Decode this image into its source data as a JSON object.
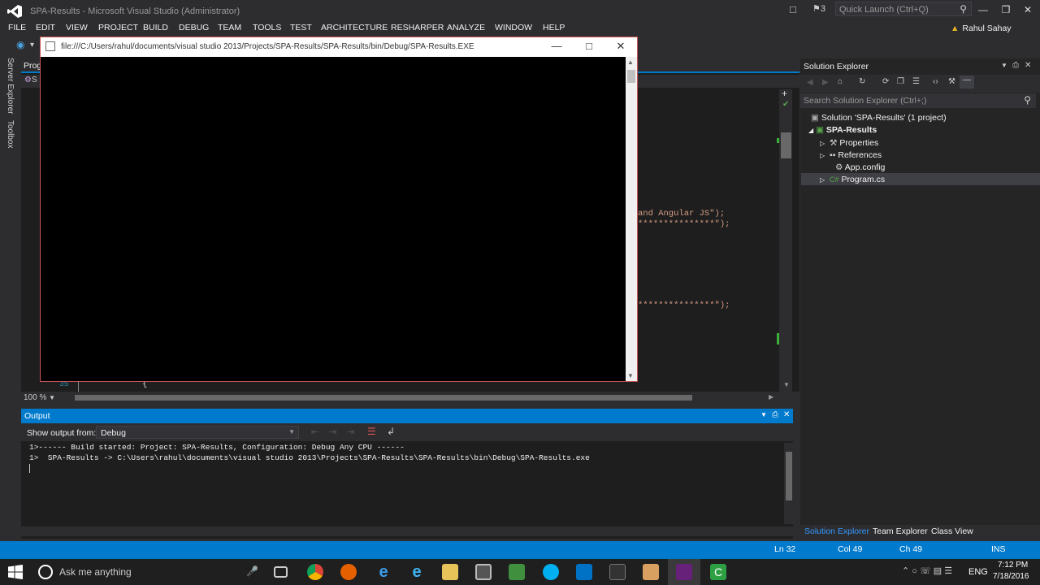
{
  "window": {
    "title": "SPA-Results - Microsoft Visual Studio (Administrator)",
    "notifications": "3",
    "quick_launch_placeholder": "Quick Launch (Ctrl+Q)",
    "user": "Rahul Sahay"
  },
  "menu": [
    "FILE",
    "EDIT",
    "VIEW",
    "PROJECT",
    "BUILD",
    "DEBUG",
    "TEAM",
    "TOOLS",
    "TEST",
    "ARCHITECTURE",
    "RESHARPER",
    "ANALYZE",
    "WINDOW",
    "HELP"
  ],
  "left_tabs": [
    "Server Explorer",
    "Toolbox"
  ],
  "editor": {
    "tab": "Prog",
    "nav_prefix": "S",
    "line_number": "35",
    "brace": "{",
    "code_fragments": [
      "and Angular JS\");",
      "***************\");",
      "***************\");"
    ],
    "zoom": "100 %"
  },
  "console": {
    "path": "file:///C:/Users/rahul/documents/visual studio 2013/Projects/SPA-Results/SPA-Results/bin/Debug/SPA-Results.EXE"
  },
  "output": {
    "title": "Output",
    "show_label": "Show output from:",
    "source": "Debug",
    "lines": [
      "1>------ Build started: Project: SPA-Results, Configuration: Debug Any CPU ------",
      "1>  SPA-Results -> C:\\Users\\rahul\\documents\\visual studio 2013\\Projects\\SPA-Results\\SPA-Results\\bin\\Debug\\SPA-Results.exe"
    ]
  },
  "solution_explorer": {
    "title": "Solution Explorer",
    "search_placeholder": "Search Solution Explorer (Ctrl+;)",
    "tree": {
      "solution": "Solution 'SPA-Results' (1 project)",
      "project": "SPA-Results",
      "items": [
        "Properties",
        "References",
        "App.config",
        "Program.cs"
      ]
    },
    "tabs": [
      "Solution Explorer",
      "Team Explorer",
      "Class View"
    ]
  },
  "status": {
    "line": "Ln 32",
    "col": "Col 49",
    "ch": "Ch 49",
    "mode": "INS"
  },
  "taskbar": {
    "search_placeholder": "Ask me anything",
    "language": "ENG",
    "time": "7:12 PM",
    "date": "7/18/2016"
  },
  "colors": {
    "accent": "#007acc",
    "vs_purple": "#68217a",
    "code_string": "#d69d85"
  }
}
